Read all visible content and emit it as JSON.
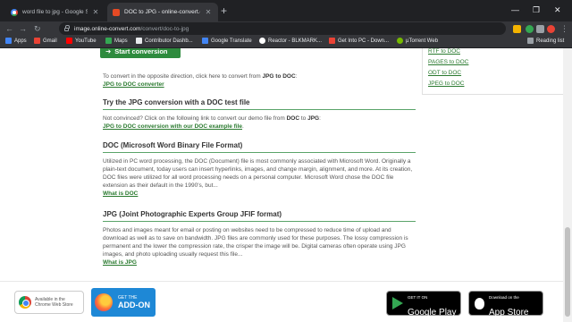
{
  "tabs": [
    {
      "title": "word file to jpg - Google Search"
    },
    {
      "title": "DOC to JPG - online-convert.com"
    }
  ],
  "address": {
    "host": "image.online-convert.com",
    "path": "/convert/doc-to-jpg"
  },
  "bookmarks": [
    {
      "label": "Apps",
      "color": "#4285f4"
    },
    {
      "label": "Gmail",
      "color": "#ea4335"
    },
    {
      "label": "YouTube",
      "color": "#ff0000"
    },
    {
      "label": "Maps",
      "color": "#34a853"
    },
    {
      "label": "Contributor Dashb...",
      "color": "#e8eaed"
    },
    {
      "label": "Google Translate",
      "color": "#4285f4"
    },
    {
      "label": "Reactor - BLKMARK...",
      "color": "#ffffff"
    },
    {
      "label": "Get Into PC - Down...",
      "color": "#ea4335"
    },
    {
      "label": "µTorrent Web",
      "color": "#76b900"
    }
  ],
  "reading_list": "Reading list",
  "start_button": "Start conversion",
  "convert_opposite": {
    "text_pre": "To convert in the opposite direction, click here to convert from ",
    "text_bold": "JPG to DOC",
    "text_post": ":",
    "link": "JPG to DOC converter"
  },
  "test_section": {
    "heading": "Try the JPG conversion with a DOC test file",
    "t1": "Not convinced? Click on the following link to convert our demo file from ",
    "b1": "DOC",
    "t2": " to ",
    "b2": "JPG",
    "t3": ":",
    "link": "JPG to DOC conversion with our DOC example file",
    "after_link": "."
  },
  "doc_section": {
    "heading": "DOC (Microsoft Word Binary File Format)",
    "body": "Utilized in PC word processing, the DOC (Document) file is most commonly associated with Microsoft Word. Originally a plain-text document, today users can insert hyperlinks, images, and change margin, alignment, and more. At its creation, DOC files were utilized for all word processing needs on a personal computer. Microsoft Word chose the DOC file extension as their default in the 1990's, but...",
    "link": "What is DOC"
  },
  "jpg_section": {
    "heading": "JPG (Joint Photographic Experts Group JFIF format)",
    "body": "Photos and images meant for email or posting on websites need to be compressed to reduce time of upload and download as well as to save on bandwidth. JPG files are commonly used for these purposes. The lossy compression is permanent and the lower the compression rate, the crisper the image will be. Digital cameras often operate using JPG images, and photo uploading usually request this file...",
    "link": "What is JPG"
  },
  "sidebar_links": [
    "RTF to DOC",
    "PAGES to DOC",
    "ODT to DOC",
    "JPEG to DOC"
  ],
  "footer": {
    "chrome_small": "Available in the",
    "chrome_big": "Chrome Web Store",
    "ff_small": "GET THE",
    "ff_big": "ADD-ON",
    "gp_small": "GET IT ON",
    "gp_big": "Google Play",
    "as_small": "Download on the",
    "as_big": "App Store"
  }
}
